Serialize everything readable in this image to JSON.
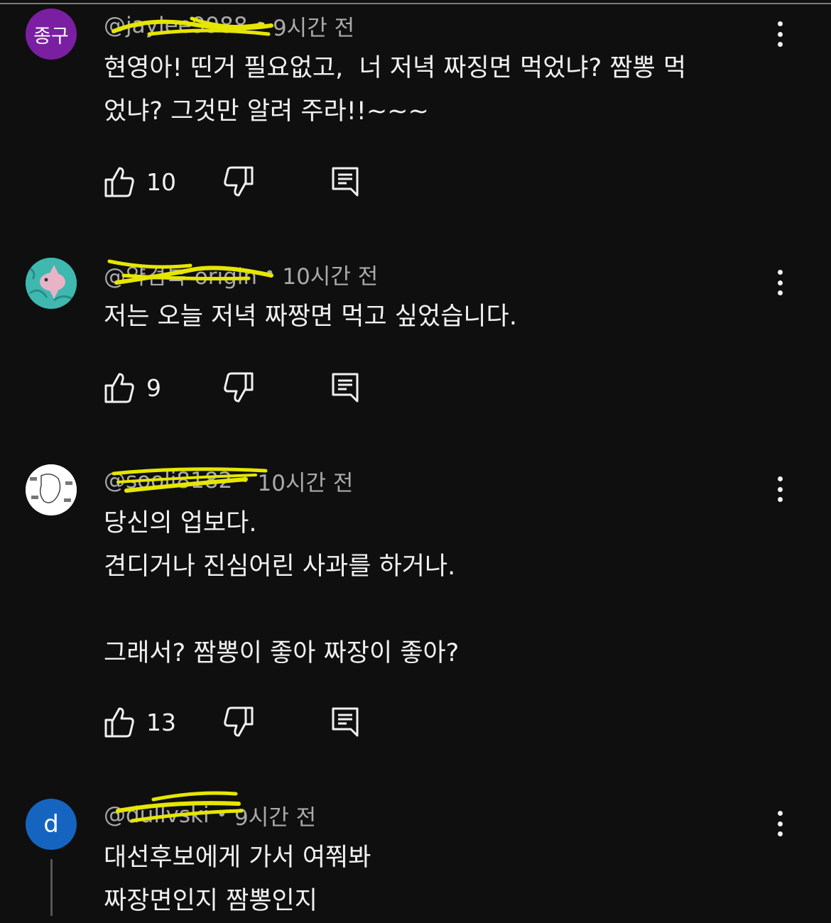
{
  "comments": [
    {
      "avatar_text": "종구",
      "avatar_color": "#7b1fa2",
      "author": "@jaylee9988",
      "time": "9시간 전",
      "lines": [
        "현영아! 띤거 필요없고,  너 저녁 짜징면 먹었냐? 짬뽕 먹",
        "었냐? 그것만 알려 주라!!~~~"
      ],
      "likes": "10"
    },
    {
      "avatar_text": "",
      "avatar_color": "#3fb8b0",
      "author": "@약검특-origin",
      "time": "10시간 전",
      "lines": [
        "저는 오늘 저녁 짜짱면 먹고 싶었습니다."
      ],
      "likes": "9"
    },
    {
      "avatar_text": "",
      "avatar_color": "#ffffff",
      "author": "@sooli8182",
      "time": "10시간 전",
      "lines": [
        "당신의 업보다.",
        "견디거나 진심어린 사과를 하거나.",
        "",
        "그래서? 짬뽕이 좋아 짜장이 좋아?"
      ],
      "likes": "13"
    },
    {
      "avatar_text": "d",
      "avatar_color": "#1565c0",
      "author": "@dullvski",
      "time": "9시간 전",
      "lines": [
        "대선후보에게 가서 여쭤봐",
        "짜장면인지 짬뽕인지"
      ],
      "likes": ""
    }
  ],
  "separator": "•",
  "scribble_color": "#e6e600",
  "icons": {
    "like": "thumbs-up-icon",
    "dislike": "thumbs-down-icon",
    "reply": "reply-icon",
    "more": "more-vert-icon"
  }
}
